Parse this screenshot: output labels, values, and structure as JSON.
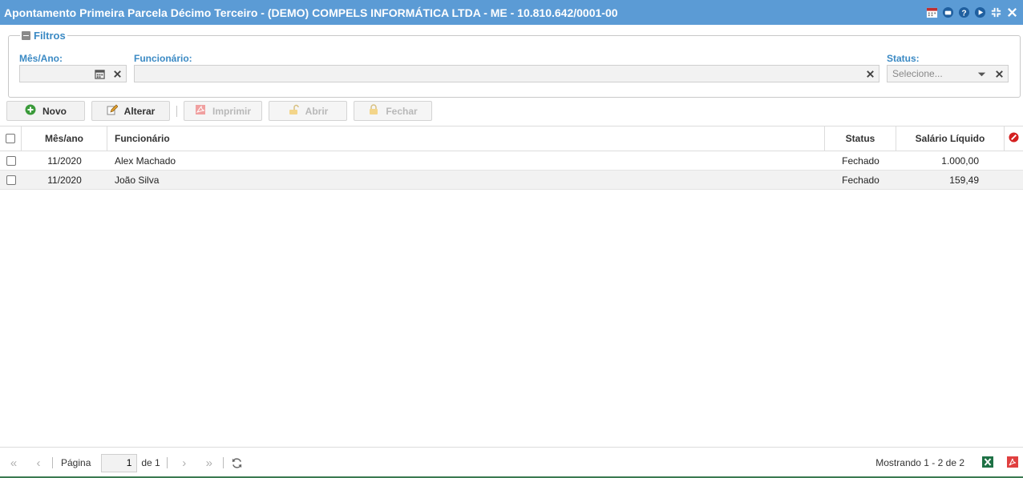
{
  "window": {
    "title": "Apontamento Primeira Parcela Décimo Terceiro - (DEMO) COMPELS INFORMÁTICA LTDA - ME - 10.810.642/0001-00",
    "tools": [
      "calendar-icon",
      "chat-icon",
      "help-icon",
      "play-icon",
      "restore-icon",
      "close-icon"
    ]
  },
  "filters": {
    "legend": "Filtros",
    "mes_ano": {
      "label": "Mês/Ano:",
      "value": ""
    },
    "funcionario": {
      "label": "Funcionário:",
      "value": ""
    },
    "status": {
      "label": "Status:",
      "placeholder": "Selecione..."
    }
  },
  "toolbar": {
    "novo": "Novo",
    "alterar": "Alterar",
    "imprimir": "Imprimir",
    "abrir": "Abrir",
    "fechar": "Fechar"
  },
  "grid": {
    "columns": {
      "mes_ano": "Mês/ano",
      "funcionario": "Funcionário",
      "status": "Status",
      "salario": "Salário Líquido"
    },
    "rows": [
      {
        "mes_ano": "11/2020",
        "funcionario": "Alex Machado",
        "status": "Fechado",
        "salario": "1.000,00"
      },
      {
        "mes_ano": "11/2020",
        "funcionario": "João Silva",
        "status": "Fechado",
        "salario": "159,49"
      }
    ]
  },
  "pager": {
    "page_label": "Página",
    "page_value": "1",
    "of_label": "de 1",
    "summary": "Mostrando 1 - 2 de 2"
  },
  "colors": {
    "titlebar": "#5b9bd5",
    "label": "#3b8ac4",
    "excel": "#1e7145",
    "pdf": "#e04040"
  }
}
